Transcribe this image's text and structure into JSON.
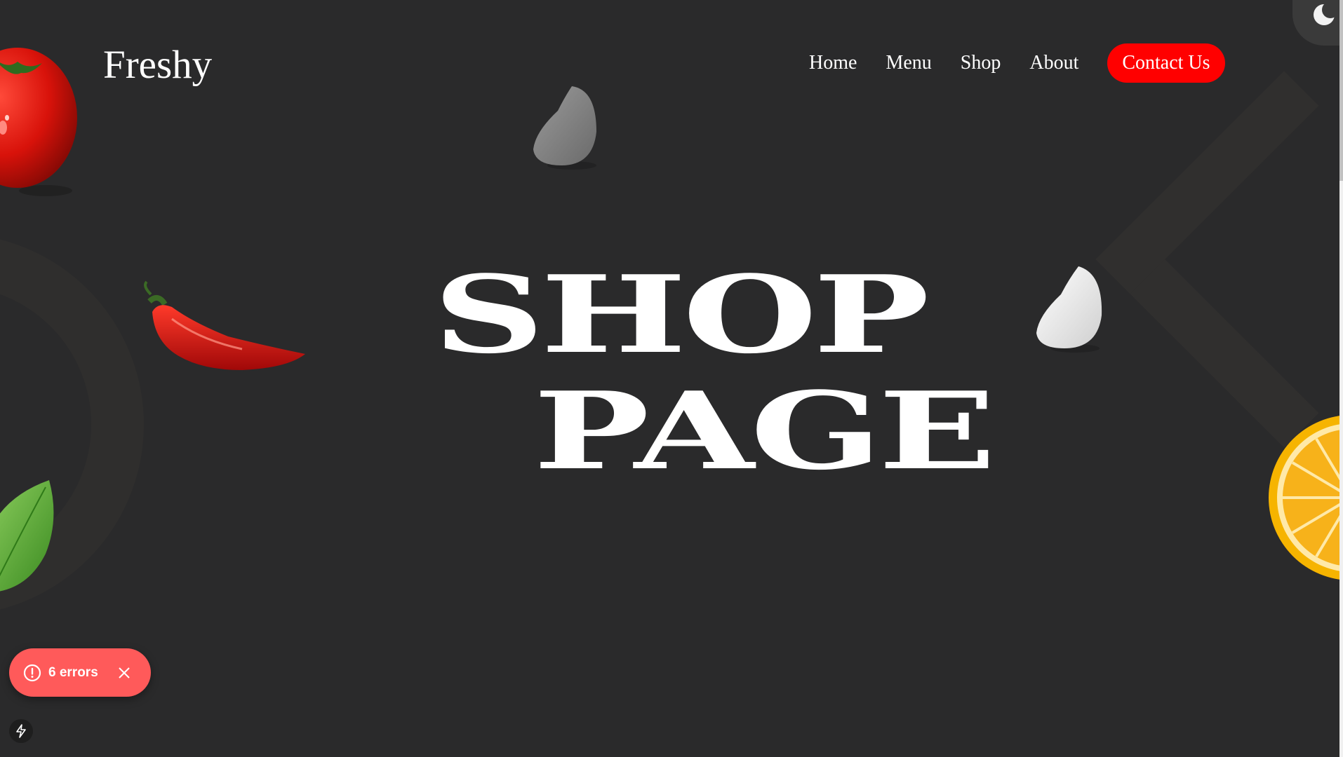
{
  "header": {
    "logo": "Freshy",
    "nav": [
      {
        "label": "Home"
      },
      {
        "label": "Menu"
      },
      {
        "label": "Shop"
      },
      {
        "label": "About"
      }
    ],
    "contact_label": "Contact Us"
  },
  "hero": {
    "line1": "SHOP",
    "line2": "PAGE"
  },
  "dev_overlay": {
    "errors_label": "6 errors"
  },
  "colors": {
    "background": "#2a2a2b",
    "accent": "#ff0000",
    "error_toast": "#ff5a5a",
    "text": "#ffffff"
  },
  "icons": {
    "theme_toggle": "moon-icon",
    "error": "alert-circle-icon",
    "close": "close-icon",
    "bolt": "lightning-icon"
  }
}
